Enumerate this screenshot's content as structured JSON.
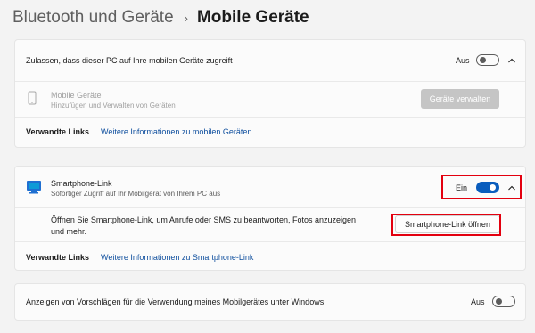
{
  "breadcrumb": {
    "parent": "Bluetooth und Geräte",
    "separator": "›",
    "current": "Mobile Geräte"
  },
  "section1": {
    "allow_label": "Zulassen, dass dieser PC auf Ihre mobilen Geräte zugreift",
    "allow_toggle_state": "Aus",
    "mobile_devices_title": "Mobile Geräte",
    "mobile_devices_subtitle": "Hinzufügen und Verwalten von Geräten",
    "manage_button": "Geräte verwalten",
    "related_links_label": "Verwandte Links",
    "related_link": "Weitere Informationen zu mobilen Geräten"
  },
  "section2": {
    "title": "Smartphone-Link",
    "subtitle": "Sofortiger Zugriff auf Ihr Mobilgerät von Ihrem PC aus",
    "toggle_state": "Ein",
    "description_line1": "Öffnen Sie Smartphone-Link, um Anrufe oder SMS zu beantworten, Fotos anzuzeigen",
    "description_line2": "und mehr.",
    "open_button": "Smartphone-Link öffnen",
    "related_links_label": "Verwandte Links",
    "related_link": "Weitere Informationen zu Smartphone-Link"
  },
  "section3": {
    "label": "Anzeigen von Vorschlägen für die Verwendung meines Mobilgerätes unter Windows",
    "toggle_state": "Aus"
  },
  "colors": {
    "accent": "#0a5dbd",
    "highlight": "#e3000f",
    "link": "#0f4f9e"
  }
}
